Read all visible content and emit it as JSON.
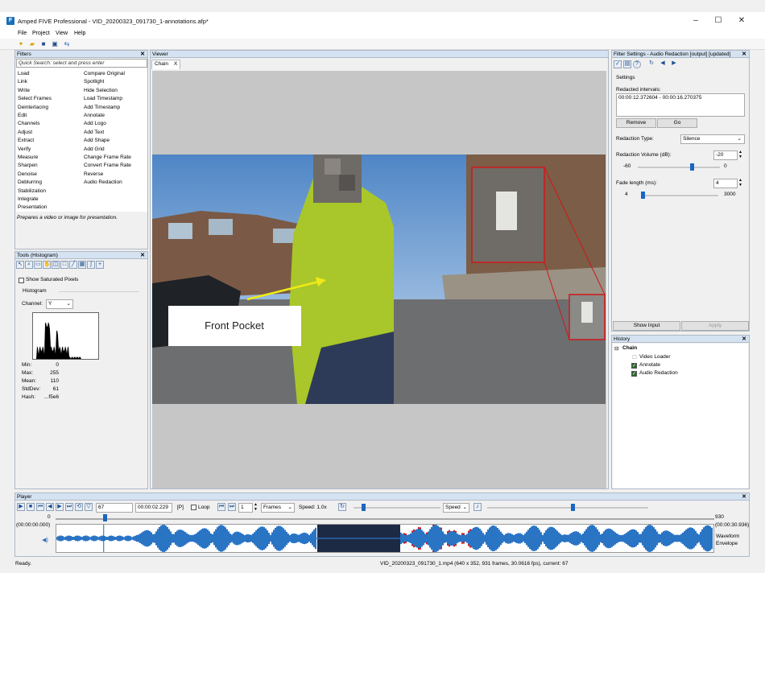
{
  "window": {
    "title": "Amped FIVE Professional - VID_20200323_091730_1-annotations.afp*",
    "app_icon": "five-logo-icon"
  },
  "menu": [
    "File",
    "Project",
    "View",
    "Help"
  ],
  "filters_panel": {
    "header": "Filters",
    "search_placeholder": "Quick Search: select and press enter",
    "categories": [
      "Load",
      "Link",
      "Write",
      "Select Frames",
      "Deinterlacing",
      "Edit",
      "Channels",
      "Adjust",
      "Extract",
      "Verify",
      "Measure",
      "Sharpen",
      "Denoise",
      "Deblurring",
      "Stabilization",
      "Integrate",
      "Presentation"
    ],
    "presentation_filters": [
      "Compare Original",
      "Spotlight",
      "Hide Selection",
      "Load Timestamp",
      "Add Timestamp",
      "Annotate",
      "Add Logo",
      "Add Text",
      "Add Shape",
      "Add Grid",
      "Change Frame Rate",
      "Convert Frame Rate",
      "Reverse",
      "Audio Redaction"
    ],
    "description": "Prepares a video or image for presentation."
  },
  "tools_panel": {
    "header": "Tools (Histogram)",
    "show_saturated": "Show Saturated Pixels",
    "histogram_label": "Histogram",
    "channel_label": "Channel:",
    "channel_value": "Y",
    "stats": [
      {
        "k": "Min:",
        "v": "0"
      },
      {
        "k": "Max:",
        "v": "255"
      },
      {
        "k": "Mean:",
        "v": "110"
      },
      {
        "k": "StdDev:",
        "v": "61"
      },
      {
        "k": "Hash:",
        "v": "...f5e6"
      }
    ]
  },
  "viewer": {
    "header": "Viewer",
    "tab_label": "Chain",
    "tab_close": "X",
    "annotation_text": "Front Pocket"
  },
  "filter_settings": {
    "header": "Filter Settings - Audio Redaction [output] [updated]",
    "settings_label": "Settings",
    "redacted_intervals_label": "Redacted intervals:",
    "interval_value": "00:00:12.372604 - 00:00:16.270375",
    "remove_label": "Remove",
    "go_label": "Go",
    "redaction_type_label": "Redaction Type:",
    "redaction_type_value": "Silence",
    "volume_label": "Redaction Volume (dB):",
    "volume_value": "-20",
    "volume_min": "-60",
    "volume_max": "0",
    "volume_fraction": 0.67,
    "fade_label": "Fade length (ms):",
    "fade_value": "4",
    "fade_min": "4",
    "fade_max": "3000",
    "fade_fraction": 0.0,
    "show_input_label": "Show Input",
    "apply_label": "Apply"
  },
  "history": {
    "header": "History",
    "root": "Chain",
    "items": [
      "Video Loader",
      "Annotate",
      "Audio Redaction"
    ]
  },
  "player": {
    "header": "Player",
    "frame_value": "67",
    "time_value": "00:00:02.229",
    "p_label": "[P]",
    "loop_label": "Loop",
    "step_value": "1",
    "step_unit": "Frames",
    "speed_label": "Speed: 1.0x",
    "speed_select": "Speed",
    "range_start": "0",
    "range_start_time": "(00:00:00.000)",
    "range_end": "930",
    "range_end_time": "(00:00:30.936)",
    "waveform_label": "Waveform",
    "envelope_label": "Envelope",
    "position_fraction": 0.072
  },
  "status": {
    "left": "Ready.",
    "right": "VID_20200323_091730_1.mp4 (640 x 352, 931 frames, 30.0616 fps), current: 67"
  }
}
